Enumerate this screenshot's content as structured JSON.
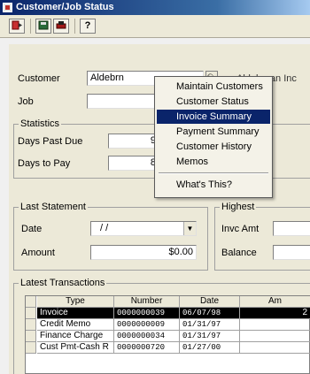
{
  "window": {
    "title": "Customer/Job Status"
  },
  "toolbar": {
    "buttons": [
      "exit-icon",
      "save-icon",
      "print-icon",
      "help-icon"
    ],
    "help_label": "?"
  },
  "customer": {
    "label": "Customer",
    "value": "Aldebrn",
    "name_partial": "Aldebaran Inc"
  },
  "job": {
    "label": "Job",
    "value": ""
  },
  "statistics": {
    "label": "Statistics",
    "days_past_due_label": "Days Past Due",
    "days_past_due_value": "9",
    "days_to_pay_label": "Days to Pay",
    "days_to_pay_value": "8"
  },
  "context_menu": {
    "items": [
      {
        "label": "Maintain Customers",
        "selected": false
      },
      {
        "label": "Customer Status",
        "selected": false
      },
      {
        "label": "Invoice Summary",
        "selected": true
      },
      {
        "label": "Payment Summary",
        "selected": false
      },
      {
        "label": "Customer History",
        "selected": false
      },
      {
        "label": "Memos",
        "selected": false
      },
      {
        "label": "What's This?",
        "selected": false
      }
    ]
  },
  "last_statement": {
    "label": "Last Statement",
    "date_label": "Date",
    "date_value": "/ /",
    "amount_label": "Amount",
    "amount_value": "$0.00"
  },
  "highest": {
    "label": "Highest",
    "invc_amt_label": "Invc Amt",
    "balance_label": "Balance"
  },
  "transactions": {
    "label": "Latest Transactions",
    "columns": [
      "Type",
      "Number",
      "Date",
      "Am"
    ],
    "rows": [
      {
        "type": "Invoice",
        "number": "0000000039",
        "date": "06/07/98",
        "amount": "2",
        "selected": true
      },
      {
        "type": "Credit Memo",
        "number": "0000000009",
        "date": "01/31/97",
        "amount": "",
        "selected": false
      },
      {
        "type": "Finance Charge",
        "number": "0000000034",
        "date": "01/31/97",
        "amount": "",
        "selected": false
      },
      {
        "type": "Cust Pmt-Cash R",
        "number": "0000000720",
        "date": "01/27/00",
        "amount": "",
        "selected": false
      }
    ]
  },
  "colors": {
    "title_bar": "#0a246a",
    "selection": "#0a246a",
    "panel": "#ece9d8"
  }
}
